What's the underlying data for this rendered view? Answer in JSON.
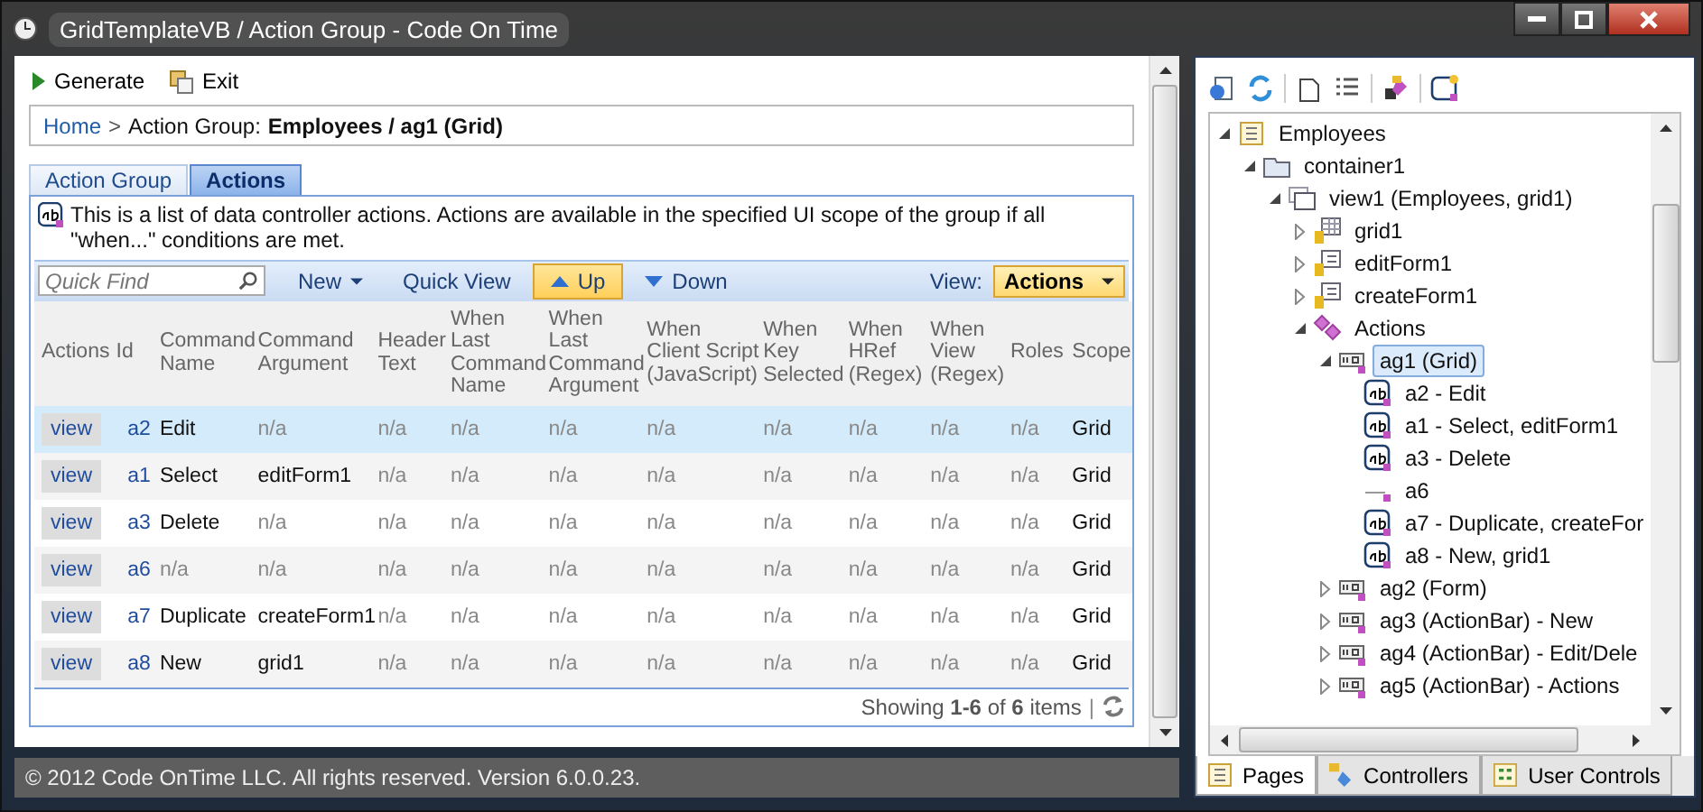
{
  "window": {
    "title": "GridTemplateVB / Action Group - Code On Time"
  },
  "toolbar": [
    {
      "label": "Generate",
      "kind": "play"
    },
    {
      "label": "Exit",
      "kind": "exit"
    }
  ],
  "breadcrumb": {
    "home": "Home",
    "separator": ">",
    "prefix": "Action Group:",
    "current": "Employees / ag1 (Grid)"
  },
  "tabs": [
    {
      "label": "Action Group",
      "selected": false
    },
    {
      "label": "Actions",
      "selected": true
    }
  ],
  "description": "This is a list of data controller actions. Actions are available in the specified UI scope of the group if all \"when...\" conditions are met.",
  "grid_toolbar": {
    "search": {
      "placeholder": "Quick Find"
    },
    "buttons": [
      {
        "label": "New",
        "kind": "menu",
        "selected": false
      },
      {
        "label": "Quick View",
        "kind": "plain",
        "selected": false
      },
      {
        "label": "Up",
        "kind": "up",
        "selected": true
      },
      {
        "label": "Down",
        "kind": "down",
        "selected": false
      }
    ],
    "view_label": "View:",
    "view_value": "Actions"
  },
  "table": {
    "columns": [
      "Actions",
      "Id",
      "Command Name",
      "Command Argument",
      "Header Text",
      "When Last Command Name",
      "When Last Command Argument",
      "When Client Script (JavaScript)",
      "When Key Selected",
      "When HRef (Regex)",
      "When View (Regex)",
      "Roles",
      "Scope"
    ],
    "rows": [
      {
        "selected": true,
        "cells": [
          {
            "text": "view",
            "kind": "link"
          },
          {
            "text": "a2",
            "kind": "id"
          },
          {
            "text": "Edit"
          },
          {
            "text": "n/a",
            "dim": true
          },
          {
            "text": "n/a",
            "dim": true
          },
          {
            "text": "n/a",
            "dim": true
          },
          {
            "text": "n/a",
            "dim": true
          },
          {
            "text": "n/a",
            "dim": true
          },
          {
            "text": "n/a",
            "dim": true
          },
          {
            "text": "n/a",
            "dim": true
          },
          {
            "text": "n/a",
            "dim": true
          },
          {
            "text": "n/a",
            "dim": true
          },
          {
            "text": "Grid"
          }
        ]
      },
      {
        "selected": false,
        "cells": [
          {
            "text": "view",
            "kind": "link"
          },
          {
            "text": "a1",
            "kind": "id"
          },
          {
            "text": "Select"
          },
          {
            "text": "editForm1"
          },
          {
            "text": "n/a",
            "dim": true
          },
          {
            "text": "n/a",
            "dim": true
          },
          {
            "text": "n/a",
            "dim": true
          },
          {
            "text": "n/a",
            "dim": true
          },
          {
            "text": "n/a",
            "dim": true
          },
          {
            "text": "n/a",
            "dim": true
          },
          {
            "text": "n/a",
            "dim": true
          },
          {
            "text": "n/a",
            "dim": true
          },
          {
            "text": "Grid"
          }
        ]
      },
      {
        "selected": false,
        "cells": [
          {
            "text": "view",
            "kind": "link"
          },
          {
            "text": "a3",
            "kind": "id"
          },
          {
            "text": "Delete"
          },
          {
            "text": "n/a",
            "dim": true
          },
          {
            "text": "n/a",
            "dim": true
          },
          {
            "text": "n/a",
            "dim": true
          },
          {
            "text": "n/a",
            "dim": true
          },
          {
            "text": "n/a",
            "dim": true
          },
          {
            "text": "n/a",
            "dim": true
          },
          {
            "text": "n/a",
            "dim": true
          },
          {
            "text": "n/a",
            "dim": true
          },
          {
            "text": "n/a",
            "dim": true
          },
          {
            "text": "Grid"
          }
        ]
      },
      {
        "selected": false,
        "cells": [
          {
            "text": "view",
            "kind": "link"
          },
          {
            "text": "a6",
            "kind": "id"
          },
          {
            "text": "n/a",
            "dim": true
          },
          {
            "text": "n/a",
            "dim": true
          },
          {
            "text": "n/a",
            "dim": true
          },
          {
            "text": "n/a",
            "dim": true
          },
          {
            "text": "n/a",
            "dim": true
          },
          {
            "text": "n/a",
            "dim": true
          },
          {
            "text": "n/a",
            "dim": true
          },
          {
            "text": "n/a",
            "dim": true
          },
          {
            "text": "n/a",
            "dim": true
          },
          {
            "text": "n/a",
            "dim": true
          },
          {
            "text": "Grid"
          }
        ]
      },
      {
        "selected": false,
        "cells": [
          {
            "text": "view",
            "kind": "link"
          },
          {
            "text": "a7",
            "kind": "id"
          },
          {
            "text": "Duplicate"
          },
          {
            "text": "createForm1"
          },
          {
            "text": "n/a",
            "dim": true
          },
          {
            "text": "n/a",
            "dim": true
          },
          {
            "text": "n/a",
            "dim": true
          },
          {
            "text": "n/a",
            "dim": true
          },
          {
            "text": "n/a",
            "dim": true
          },
          {
            "text": "n/a",
            "dim": true
          },
          {
            "text": "n/a",
            "dim": true
          },
          {
            "text": "n/a",
            "dim": true
          },
          {
            "text": "Grid"
          }
        ]
      },
      {
        "selected": false,
        "cells": [
          {
            "text": "view",
            "kind": "link"
          },
          {
            "text": "a8",
            "kind": "id"
          },
          {
            "text": "New"
          },
          {
            "text": "grid1"
          },
          {
            "text": "n/a",
            "dim": true
          },
          {
            "text": "n/a",
            "dim": true
          },
          {
            "text": "n/a",
            "dim": true
          },
          {
            "text": "n/a",
            "dim": true
          },
          {
            "text": "n/a",
            "dim": true
          },
          {
            "text": "n/a",
            "dim": true
          },
          {
            "text": "n/a",
            "dim": true
          },
          {
            "text": "n/a",
            "dim": true
          },
          {
            "text": "Grid"
          }
        ]
      }
    ],
    "footer": "Showing **1-6** of **6** items",
    "footer_separator": "|"
  },
  "status_bar": "© 2012 Code OnTime LLC. All rights reserved. Version 6.0.0.23.",
  "tree": [
    {
      "label": "Employees",
      "kind": "page",
      "expanded": true,
      "selected": false,
      "children": [
        {
          "label": "container1",
          "kind": "container",
          "expanded": true,
          "selected": false,
          "children": [
            {
              "label": "view1 (Employees, grid1)",
              "kind": "view",
              "expanded": true,
              "selected": false,
              "children": [
                {
                  "label": "grid1",
                  "kind": "grid",
                  "expanded": false,
                  "selected": false
                },
                {
                  "label": "editForm1",
                  "kind": "form",
                  "expanded": false,
                  "selected": false
                },
                {
                  "label": "createForm1",
                  "kind": "form",
                  "expanded": false,
                  "selected": false
                },
                {
                  "label": "Actions",
                  "kind": "actions",
                  "expanded": true,
                  "selected": false,
                  "children": [
                    {
                      "label": "ag1 (Grid)",
                      "kind": "group",
                      "expanded": true,
                      "selected": true,
                      "children": [
                        {
                          "label": "a2 - Edit",
                          "kind": "action",
                          "selected": false
                        },
                        {
                          "label": "a1 - Select, editForm1",
                          "kind": "action",
                          "selected": false
                        },
                        {
                          "label": "a3 - Delete",
                          "kind": "action",
                          "selected": false
                        },
                        {
                          "label": "a6",
                          "kind": "separator",
                          "selected": false
                        },
                        {
                          "label": "a7 - Duplicate, createFor",
                          "kind": "action",
                          "selected": false
                        },
                        {
                          "label": "a8 - New, grid1",
                          "kind": "action",
                          "selected": false
                        }
                      ]
                    },
                    {
                      "label": "ag2 (Form)",
                      "kind": "group",
                      "expanded": false,
                      "selected": false
                    },
                    {
                      "label": "ag3 (ActionBar) - New",
                      "kind": "group",
                      "expanded": false,
                      "selected": false
                    },
                    {
                      "label": "ag4 (ActionBar) - Edit/Dele",
                      "kind": "group",
                      "expanded": false,
                      "selected": false
                    },
                    {
                      "label": "ag5 (ActionBar) - Actions",
                      "kind": "group",
                      "expanded": false,
                      "selected": false
                    }
                  ]
                }
              ]
            }
          ]
        }
      ]
    }
  ],
  "bottom_tabs": [
    {
      "label": "Pages",
      "kind": "pages",
      "selected": true
    },
    {
      "label": "Controllers",
      "kind": "controllers",
      "selected": false
    },
    {
      "label": "User Controls",
      "kind": "controls",
      "selected": false
    }
  ]
}
